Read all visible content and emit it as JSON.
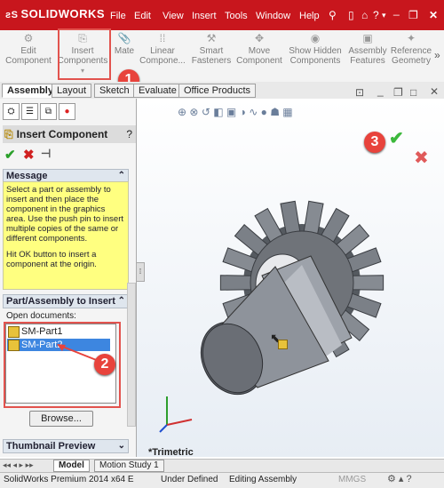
{
  "app": {
    "name": "SOLIDWORKS",
    "brand_color": "#c8161d"
  },
  "menu": [
    "File",
    "Edit",
    "View",
    "Insert",
    "Tools",
    "Window",
    "Help"
  ],
  "command_manager": [
    {
      "label": "Edit Component",
      "icon": "edit-component-icon"
    },
    {
      "label": "Insert Components",
      "icon": "insert-components-icon"
    },
    {
      "label": "Mate",
      "icon": "mate-icon"
    },
    {
      "label": "Linear Compone...",
      "icon": "linear-pattern-icon"
    },
    {
      "label": "Smart Fasteners",
      "icon": "smart-fasteners-icon"
    },
    {
      "label": "Move Component",
      "icon": "move-component-icon"
    },
    {
      "label": "Show Hidden Components",
      "icon": "show-hidden-icon"
    },
    {
      "label": "Assembly Features",
      "icon": "assembly-features-icon"
    },
    {
      "label": "Reference Geometry",
      "icon": "reference-geometry-icon"
    }
  ],
  "cm_tabs": [
    "Assembly",
    "Layout",
    "Sketch",
    "Evaluate",
    "Office Products"
  ],
  "property_manager": {
    "title": "Insert Component",
    "message_header": "Message",
    "message_p1": "Select a part or assembly to insert and then place the component in the graphics area. Use the push pin to insert multiple copies of the same or different components.",
    "message_p2": "Hit OK button to insert a component at the origin.",
    "part_header": "Part/Assembly to Insert",
    "open_docs_label": "Open documents:",
    "documents": [
      "SM-Part1",
      "SM-Part2"
    ],
    "selected_document": "SM-Part2",
    "browse_label": "Browse...",
    "thumbnail_header": "Thumbnail Preview"
  },
  "callouts": [
    "1",
    "2",
    "3"
  ],
  "view": {
    "orientation_label": "*Trimetric"
  },
  "bottom_tabs": [
    "Model",
    "Motion Study 1"
  ],
  "status": {
    "product": "SolidWorks Premium 2014 x64 E",
    "state": "Under Defined",
    "mode": "Editing Assembly",
    "units": "MMGS"
  }
}
